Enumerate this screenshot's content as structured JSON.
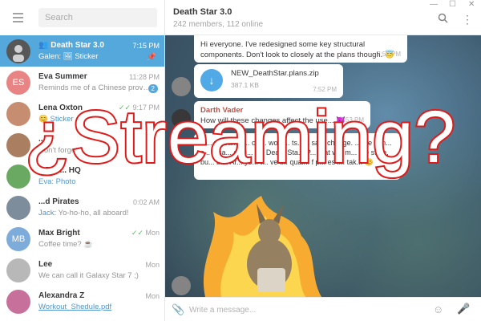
{
  "search": {
    "placeholder": "Search"
  },
  "chats": [
    {
      "name": "Death Star 3.0",
      "time": "7:15 PM",
      "sender": "Galen:",
      "message": "🖼 Sticker",
      "active": true,
      "pinned": true,
      "avatar_color": "#555"
    },
    {
      "name": "Eva Summer",
      "time": "11:28 PM",
      "message": "Reminds me of a Chinese prove...",
      "initials": "ES",
      "avatar_color": "#e67676",
      "badge": "2"
    },
    {
      "name": "Lena Oxton",
      "time": "9:17 PM",
      "message": "Sticker",
      "emoji": "😊",
      "avatar_color": "#c08060",
      "read": true
    },
    {
      "name": "...m",
      "time": "",
      "message": "Don't forget...",
      "avatar_color": "#a07050"
    },
    {
      "name": "...Pan... HQ",
      "time": "",
      "sender": "Eva: Photo",
      "message": "",
      "avatar_color": "#5aa050"
    },
    {
      "name": "...d Pirates",
      "time": "0:02 AM",
      "sender": "Jack:",
      "message": "Yo-ho-ho, all aboard!",
      "avatar_color": "#708090"
    },
    {
      "name": "Max Bright",
      "time": "Mon",
      "message": "Coffee time? ☕",
      "initials": "MB",
      "avatar_color": "#6fa3d6",
      "read": true
    },
    {
      "name": "Lee",
      "time": "Mon",
      "message": "We can call it Galaxy Star 7 ;)",
      "avatar_color": "#b0b0b0"
    },
    {
      "name": "Alexandra Z",
      "time": "Mon",
      "message": "Workout_Shedule.pdf",
      "avatar_color": "#c06090",
      "is_link": true
    }
  ],
  "header": {
    "title": "Death Star 3.0",
    "subtitle": "242 members, 112 online"
  },
  "messages": [
    {
      "text": "Hi everyone. I've redesigned some key structural components. Don't look to closely at the plans though. 😇",
      "time": "7:52 PM"
    },
    {
      "file_name": "NEW_DeathStar.plans.zip",
      "file_size": "387.1 KB",
      "time": "7:52 PM"
    },
    {
      "sender": "Darth Vader",
      "text": "How will these changes affect the use... 👿",
      "time": "7:53 PM"
    },
    {
      "text": "G... versa... a... ow... wo p... ts... a sa... ch... ge. ... we can... c... e sa... desi... y... Death Sta... P... that w... m... the s... e, bu... bi... Ar... yo... t... ve t... qual... f p... es i... tak... 😊"
    }
  ],
  "composer": {
    "placeholder": "Write a message..."
  },
  "overlay": {
    "text": "¿Streaming?"
  },
  "colors": {
    "accent": "#419fd9",
    "overlay_stroke": "#e01a1a"
  },
  "icons": [
    "hamburger-icon",
    "search-icon",
    "more-icon",
    "pin-icon",
    "download-icon",
    "attach-icon",
    "emoji-icon",
    "mic-icon"
  ]
}
